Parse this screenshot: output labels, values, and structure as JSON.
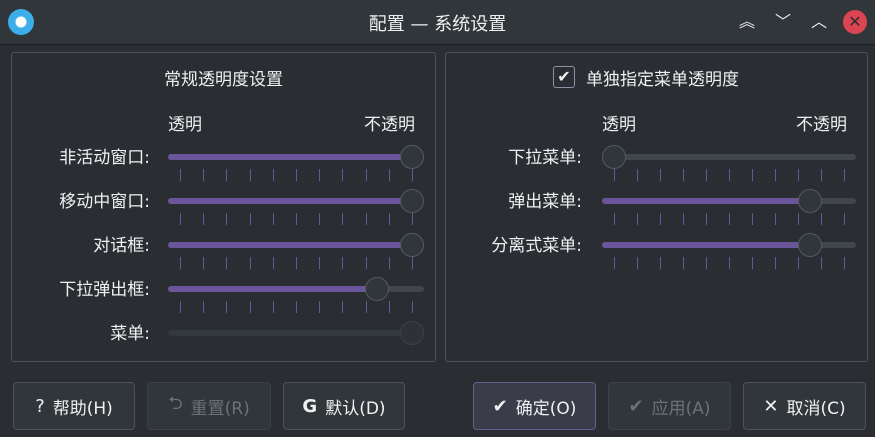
{
  "window": {
    "title": "配置 — 系统设置"
  },
  "left_group": {
    "title": "常规透明度设置",
    "label_transparent": "透明",
    "label_opaque": "不透明",
    "rows": [
      {
        "label": "非活动窗口:",
        "value": 100,
        "enabled": true
      },
      {
        "label": "移动中窗口:",
        "value": 100,
        "enabled": true
      },
      {
        "label": "对话框:",
        "value": 100,
        "enabled": true
      },
      {
        "label": "下拉弹出框:",
        "value": 85,
        "enabled": true
      },
      {
        "label": "菜单:",
        "value": 100,
        "enabled": false
      }
    ]
  },
  "right_group": {
    "title": "单独指定菜单透明度",
    "checked": true,
    "label_transparent": "透明",
    "label_opaque": "不透明",
    "rows": [
      {
        "label": "下拉菜单:",
        "value": 0,
        "enabled": true
      },
      {
        "label": "弹出菜单:",
        "value": 85,
        "enabled": true
      },
      {
        "label": "分离式菜单:",
        "value": 85,
        "enabled": true
      }
    ]
  },
  "buttons": {
    "help": {
      "icon": "?",
      "label": "帮助(H)"
    },
    "reset": {
      "icon": "⮌",
      "label": "重置(R)"
    },
    "defaults": {
      "icon": "G",
      "label": "默认(D)"
    },
    "ok": {
      "icon": "✔",
      "label": "确定(O)"
    },
    "apply": {
      "icon": "✔",
      "label": "应用(A)"
    },
    "cancel": {
      "icon": "✕",
      "label": "取消(C)"
    }
  },
  "colors": {
    "accent": "#6a559a",
    "background": "#2a2e32",
    "close": "#da4453"
  },
  "slider_ticks": 11
}
